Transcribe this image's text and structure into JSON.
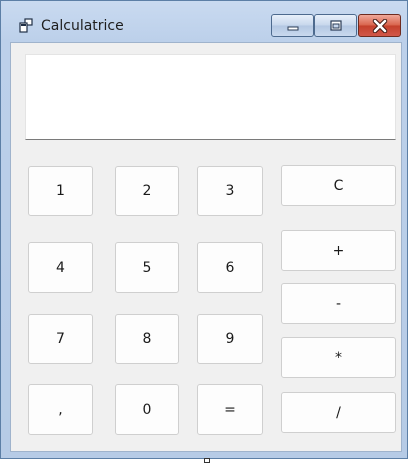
{
  "window": {
    "title": "Calculatrice"
  },
  "display": {
    "value": ""
  },
  "keys": {
    "k1": "1",
    "k2": "2",
    "k3": "3",
    "k4": "4",
    "k5": "5",
    "k6": "6",
    "k7": "7",
    "k8": "8",
    "k9": "9",
    "k0": "0",
    "comma": ",",
    "equals": "=",
    "clear": "C",
    "plus": "+",
    "minus": "-",
    "multiply": "*",
    "divide": "/"
  },
  "icons": {
    "app": "app-icon",
    "minimize": "minimize-icon",
    "maximize": "maximize-icon",
    "close": "close-icon"
  },
  "colors": {
    "close_button": "#c4402b",
    "title_bar": "#bcd0ea"
  }
}
